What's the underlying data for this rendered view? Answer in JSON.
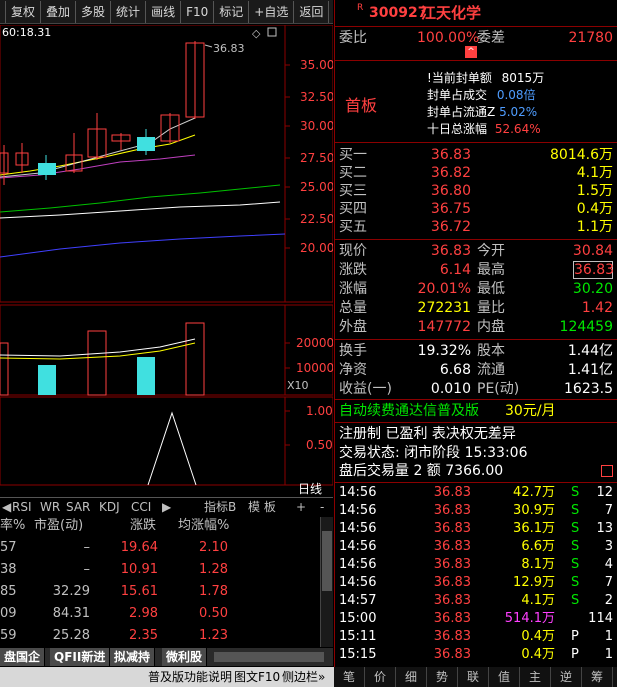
{
  "toolbar": {
    "buttons": [
      "复权",
      "叠加",
      "多股",
      "统计",
      "画线",
      "F10",
      "标记",
      "+自选",
      "返回"
    ]
  },
  "stock": {
    "code_prefix": "R",
    "code": "300927",
    "name": "江天化学"
  },
  "chart": {
    "top_label": "60:18.31",
    "high_label": "36.83",
    "price_axis": [
      "35.00",
      "32.50",
      "30.00",
      "27.50",
      "25.00",
      "22.50",
      "20.00"
    ],
    "vol_axis": [
      "20000",
      "10000"
    ],
    "vol_unit": "X10",
    "ind_axis": [
      "1.00",
      "0.50"
    ],
    "period_label": "日线",
    "indicator_tabs": [
      "RSI",
      "WR",
      "SAR",
      "KDJ",
      "CCI"
    ],
    "indicator_b": "指标B",
    "template": "模 板",
    "plus": "+",
    "minus": "-"
  },
  "table": {
    "headers": [
      "率%",
      "市盈(动)",
      "涨跌",
      "均涨幅%"
    ],
    "rows": [
      [
        "57",
        "–",
        "19.64",
        "2.10"
      ],
      [
        "38",
        "–",
        "10.91",
        "1.28"
      ],
      [
        "85",
        "32.29",
        "15.61",
        "1.78"
      ],
      [
        "09",
        "84.31",
        "2.98",
        "0.50"
      ],
      [
        "59",
        "25.28",
        "2.35",
        "1.23"
      ]
    ]
  },
  "bottom_tabs": [
    "盘国企",
    "QFII新进",
    "拟减持",
    "微利股"
  ],
  "status_bar": {
    "text1": "普及版功能说明",
    "text2": "图文F10",
    "text3": "侧边栏»"
  },
  "quote": {
    "weibi_label": "委比",
    "weibi_value": "100.00%",
    "weicha_label": "委差",
    "weicha_value": "21780",
    "board_label": "首板",
    "seal_amount_label": "当前封单额",
    "seal_amount_value": "8015万",
    "seal_ratio_label": "封单占成交",
    "seal_ratio_value": "0.08倍",
    "seal_float_label": "封单占流通Z",
    "seal_float_value": "5.02%",
    "ten_day_label": "十日总涨幅",
    "ten_day_value": "52.64%",
    "buys": [
      {
        "label": "买一",
        "price": "36.83",
        "vol": "8014.6万"
      },
      {
        "label": "买二",
        "price": "36.82",
        "vol": "4.1万"
      },
      {
        "label": "买三",
        "price": "36.80",
        "vol": "1.5万"
      },
      {
        "label": "买四",
        "price": "36.75",
        "vol": "0.4万"
      },
      {
        "label": "买五",
        "price": "36.72",
        "vol": "1.1万"
      }
    ],
    "stats": [
      {
        "l1": "现价",
        "v1": "36.83",
        "l2": "今开",
        "v2": "30.84"
      },
      {
        "l1": "涨跌",
        "v1": "6.14",
        "l2": "最高",
        "v2": "36.83"
      },
      {
        "l1": "涨幅",
        "v1": "20.01%",
        "l2": "最低",
        "v2": "30.20"
      },
      {
        "l1": "总量",
        "v1": "272231",
        "l2": "量比",
        "v2": "1.42"
      },
      {
        "l1": "外盘",
        "v1": "147772",
        "l2": "内盘",
        "v2": "124459"
      }
    ],
    "fin": [
      {
        "l1": "换手",
        "v1": "19.32%",
        "l2": "股本",
        "v2": "1.44亿"
      },
      {
        "l1": "净资",
        "v1": "6.68",
        "l2": "流通",
        "v2": "1.41亿"
      },
      {
        "l1": "收益(一)",
        "v1": "0.010",
        "l2": "PE(动)",
        "v2": "1623.5"
      }
    ],
    "promo1": "自动续费通达信普及版",
    "promo1_price": "30元/月",
    "promo2": "注册制 已盈利 表决权无差异",
    "trade_status": "交易状态: 闭市阶段 15:33:06",
    "after_hours": "盘后交易量 2 额 7366.00"
  },
  "ticks": [
    {
      "time": "14:56",
      "price": "36.83",
      "vol": "42.7万",
      "bs": "S",
      "n": "12"
    },
    {
      "time": "14:56",
      "price": "36.83",
      "vol": "30.9万",
      "bs": "S",
      "n": "7"
    },
    {
      "time": "14:56",
      "price": "36.83",
      "vol": "36.1万",
      "bs": "S",
      "n": "13"
    },
    {
      "time": "14:56",
      "price": "36.83",
      "vol": "6.6万",
      "bs": "S",
      "n": "3"
    },
    {
      "time": "14:56",
      "price": "36.83",
      "vol": "8.1万",
      "bs": "S",
      "n": "4"
    },
    {
      "time": "14:56",
      "price": "36.83",
      "vol": "12.9万",
      "bs": "S",
      "n": "7"
    },
    {
      "time": "14:57",
      "price": "36.83",
      "vol": "4.1万",
      "bs": "S",
      "n": "2"
    },
    {
      "time": "15:00",
      "price": "36.83",
      "vol": "514.1万",
      "bs": "",
      "n": "114"
    },
    {
      "time": "15:11",
      "price": "36.83",
      "vol": "0.4万",
      "bs": "P",
      "n": "1"
    },
    {
      "time": "15:15",
      "price": "36.83",
      "vol": "0.4万",
      "bs": "P",
      "n": "1"
    }
  ],
  "right_nav": [
    "笔",
    "价",
    "细",
    "势",
    "联",
    "值",
    "主",
    "逆",
    "筹"
  ],
  "colors": {
    "up": "#ff4040",
    "down": "#00e600",
    "cyan_candle": "#40e0e0",
    "border": "#8b0000"
  }
}
